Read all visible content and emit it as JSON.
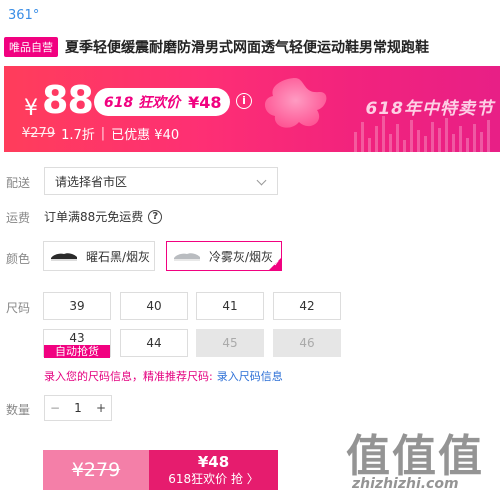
{
  "brand": "361°",
  "product": {
    "badge": "唯品自营",
    "title": "夏季轻便缓震耐磨防滑男式网面透气轻便运动鞋男常规跑鞋"
  },
  "promo": {
    "currency": "¥",
    "price": "88",
    "event_label": "618 狂欢价",
    "event_price": "¥48",
    "info_icon": "i",
    "original_price": "¥279",
    "discount": "1.7折",
    "separator": "|",
    "saved": "已优惠 ¥40",
    "festival_text": "618年中特卖节"
  },
  "labels": {
    "delivery": "配送",
    "shipping": "运费",
    "color": "颜色",
    "size": "尺码",
    "quantity": "数量"
  },
  "delivery": {
    "placeholder": "请选择省市区"
  },
  "shipping": {
    "text": "订单满88元免运费",
    "help_icon": "?"
  },
  "colors": [
    {
      "label": "曜石黑/烟灰",
      "selected": false
    },
    {
      "label": "冷雾灰/烟灰",
      "selected": true
    }
  ],
  "sizes": [
    {
      "label": "39",
      "disabled": false
    },
    {
      "label": "40",
      "disabled": false
    },
    {
      "label": "41",
      "disabled": false
    },
    {
      "label": "42",
      "disabled": false
    },
    {
      "label": "43",
      "tag": "自动抢货",
      "disabled": false
    },
    {
      "label": "44",
      "disabled": false
    },
    {
      "label": "45",
      "disabled": true
    },
    {
      "label": "46",
      "disabled": true
    }
  ],
  "size_info": {
    "text": "录入您的尺码信息，精准推荐尺码:",
    "link": "录入尺码信息"
  },
  "quantity": {
    "minus": "−",
    "value": "1",
    "plus": "+"
  },
  "buy": {
    "original": "¥279",
    "price": "¥48",
    "label": "618狂欢价 抢 〉"
  },
  "watermark": {
    "glyphs": "值值值",
    "url": "zhizhizhi.com"
  },
  "colors_theme": {
    "accent": "#f10180",
    "buy_right": "#e61c6e",
    "buy_left": "#f47fa8",
    "link": "#2c6fd6"
  }
}
